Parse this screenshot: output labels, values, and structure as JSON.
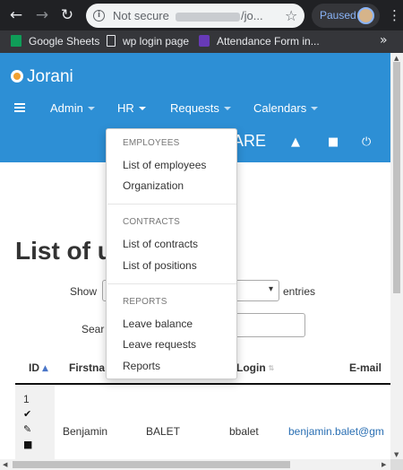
{
  "browser": {
    "back_icon": "←",
    "forward_icon": "→",
    "reload_icon": "↻",
    "info_icon": "i",
    "security_text": "Not secure",
    "url_path": "/jo...",
    "star_icon": "☆",
    "profile_status": "Paused",
    "menu_icon": "⋮"
  },
  "bookmarks": {
    "items": [
      {
        "label": "Google Sheets",
        "icon": "sheets-icon"
      },
      {
        "label": "wp login page",
        "icon": "page-icon"
      },
      {
        "label": "Attendance Form in...",
        "icon": "forms-icon"
      }
    ],
    "more_icon": "»"
  },
  "app": {
    "brand": "Jorani",
    "nav": {
      "items": [
        {
          "label": "Admin"
        },
        {
          "label": "HR"
        },
        {
          "label": "Requests"
        },
        {
          "label": "Calendars"
        }
      ]
    },
    "header_fragment": "ARE",
    "icons": {
      "user": "▲",
      "lock": "■",
      "power": "⏻"
    }
  },
  "dropdown": {
    "sections": [
      {
        "header": "EMPLOYEES",
        "items": [
          "List of employees",
          "Organization"
        ]
      },
      {
        "header": "CONTRACTS",
        "items": [
          "List of contracts",
          "List of positions"
        ]
      },
      {
        "header": "REPORTS",
        "items": [
          "Leave balance",
          "Leave requests",
          "Reports"
        ]
      }
    ]
  },
  "page": {
    "title": "List of u",
    "show_label": "Show",
    "entries_label": "entries",
    "search_label": "Sear",
    "select_caret": "▾"
  },
  "table": {
    "headers": {
      "id": "ID",
      "firstname": "Firstna",
      "login": "Login",
      "email": "E-mail"
    },
    "sort_asc": "▲",
    "sort_both": "⇅",
    "rows": [
      {
        "id": "1",
        "firstname": "Benjamin",
        "lastname": "BALET",
        "login": "bbalet",
        "email": "benjamin.balet@gm"
      }
    ],
    "row_icons": {
      "check": "✔",
      "edit": "✎",
      "delete": "■"
    }
  },
  "scrollbar": {
    "up": "▲",
    "down": "▼",
    "left": "◀",
    "right": "▶"
  }
}
